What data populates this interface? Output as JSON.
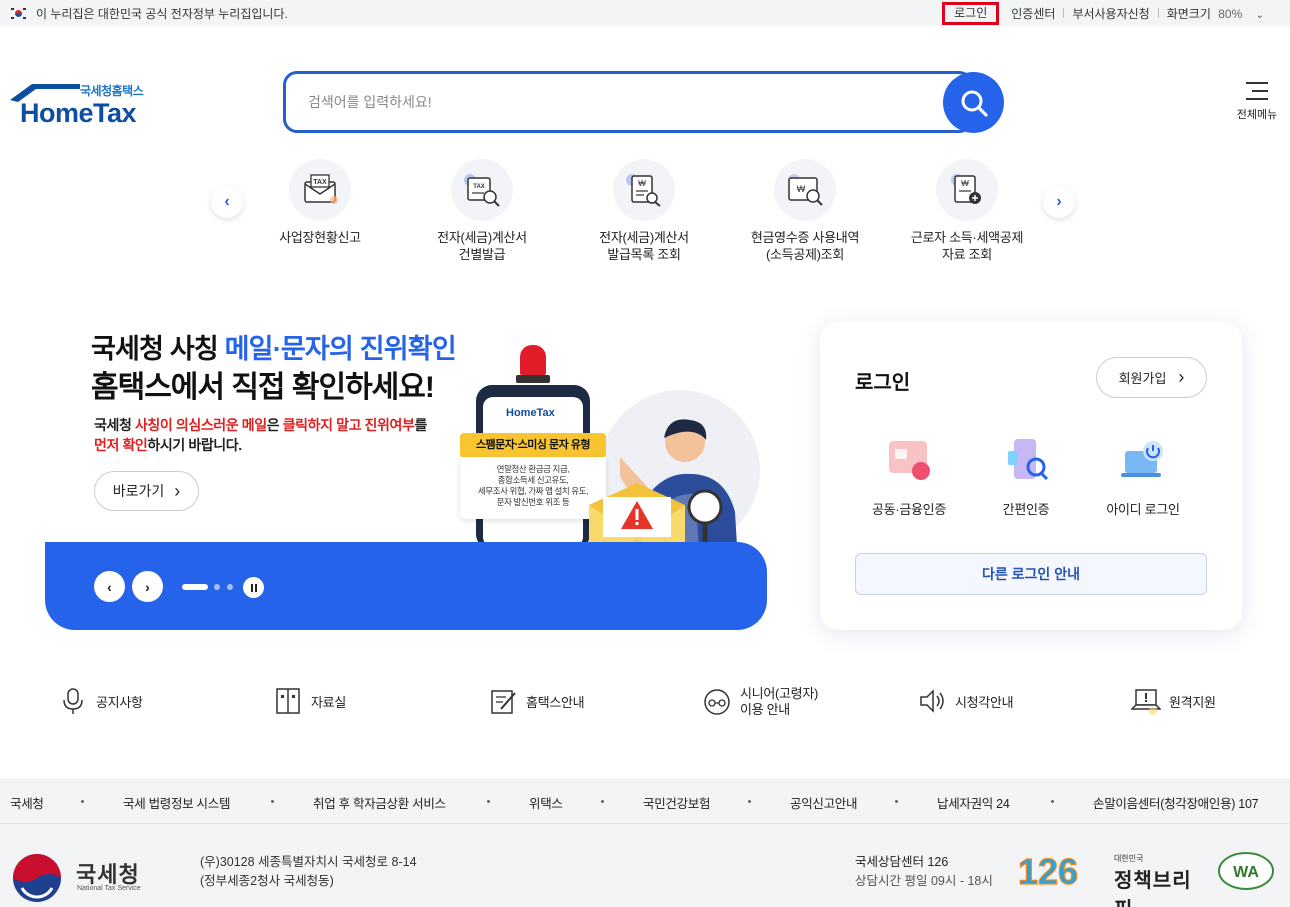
{
  "topbar": {
    "gov_notice": "이 누리집은 대한민국 공식 전자정부 누리집입니다.",
    "links": [
      "로그인",
      "인증센터",
      "부서사용자신청",
      "화면크기"
    ],
    "zoom": "80%"
  },
  "header": {
    "logo_sub": "국세청홈택스",
    "logo_main": "HomeTax",
    "search_placeholder": "검색어를 입력하세요!",
    "all_menu": "전체메뉴"
  },
  "quick_menu": [
    {
      "label": "사업장현황신고",
      "icon": "tax-envelope-icon"
    },
    {
      "label": "전자(세금)계산서\n건별발급",
      "icon": "tax-invoice-search-icon"
    },
    {
      "label": "전자(세금)계산서\n발급목록 조회",
      "icon": "invoice-list-search-icon"
    },
    {
      "label": "현금영수증 사용내역\n(소득공제)조회",
      "icon": "receipt-search-icon"
    },
    {
      "label": "근로자 소득·세액공제\n자료 조회",
      "icon": "deduction-doc-icon"
    }
  ],
  "banner": {
    "title_prefix": "국세청 사칭 ",
    "title_highlight": "메일·문자의 진위확인",
    "title_line2": "홈택스에서 직접 확인하세요!",
    "desc_1": "국세청 ",
    "desc_2": "사칭이 의심스러운 메일",
    "desc_3": "은 ",
    "desc_4": "클릭하지 말고 진위여부",
    "desc_5": "를",
    "desc_6": "먼저 확인",
    "desc_7": "하시기 바랍니다.",
    "go_button": "바로가기",
    "spam_title": "스팸문자·스미싱 문자 유형",
    "spam_body": "연말정산 환급금 지급,\n종합소득세 신고유도,\n세무조사 위협, 가짜 앱 설치 유도,\n문자 발신번호 위조 등",
    "phone_logo": "HomeTax"
  },
  "login": {
    "title": "로그인",
    "join": "회원가입",
    "options": [
      "공동·금융인증",
      "간편인증",
      "아이디 로그인"
    ],
    "other": "다른 로그인 안내"
  },
  "bottom_links": [
    {
      "label": "공지사항",
      "icon": "microphone-icon"
    },
    {
      "label": "자료실",
      "icon": "archive-icon"
    },
    {
      "label": "홈택스안내",
      "icon": "guide-edit-icon"
    },
    {
      "label": "시니어(고령자)\n이용 안내",
      "icon": "senior-icon"
    },
    {
      "label": "시청각안내",
      "icon": "speaker-icon"
    },
    {
      "label": "원격지원",
      "icon": "remote-laptop-icon"
    }
  ],
  "footer": {
    "links": [
      "국세청",
      "국세 법령정보 시스템",
      "취업 후 학자금상환 서비스",
      "위택스",
      "국민건강보험",
      "공익신고안내",
      "납세자권익 24",
      "손말이음센터(청각장애인용) 107"
    ],
    "org_name": "국세청",
    "org_en": "National Tax Service",
    "address_1": "(우)30128 세종특별자치시 국세청로 8-14",
    "address_2": "(정부세종2청사 국세청동)",
    "call_center": "국세상담센터 126",
    "call_hours": "상담시간 평일 09시 - 18시",
    "badge_126": "126",
    "brief_small": "대한민국",
    "brief_big": "정책브리핑",
    "wa": "WA"
  },
  "colors": {
    "primary": "#2563eb",
    "brand": "#0c4ea1",
    "alert": "#e02020",
    "highlight_box": "#e0001b"
  }
}
